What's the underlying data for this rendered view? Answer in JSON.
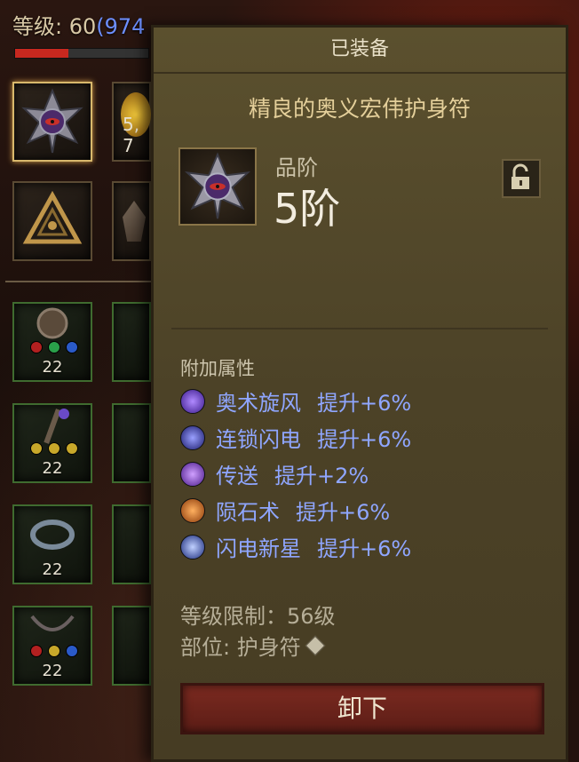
{
  "player": {
    "level_prefix": "等级: 60",
    "paragon": "(974",
    "xp_progress": 0.4
  },
  "background_slots": [
    {
      "label": "5, 7",
      "name": "bag-slot-gold"
    },
    {
      "level": "22"
    },
    {
      "level": "22"
    },
    {
      "level": "22"
    },
    {
      "level": "22"
    }
  ],
  "tooltip": {
    "header": "已装备",
    "item_name": "精良的奥义宏伟护身符",
    "tier_label": "品阶",
    "tier_value": "5阶",
    "attr_title": "附加属性",
    "attributes": [
      {
        "skill": "奥术旋风",
        "boost": "提升+6%",
        "icon": "arcane-orb-icon",
        "color": "#6a3bd6"
      },
      {
        "skill": "连锁闪电",
        "boost": "提升+6%",
        "icon": "chain-lightning-icon",
        "color": "#4a4fd0"
      },
      {
        "skill": "传送",
        "boost": "提升+2%",
        "icon": "teleport-icon",
        "color": "#8a3bd0"
      },
      {
        "skill": "陨石术",
        "boost": "提升+6%",
        "icon": "meteor-icon",
        "color": "#d26a1e"
      },
      {
        "skill": "闪电新星",
        "boost": "提升+6%",
        "icon": "lightning-nova-icon",
        "color": "#3a4ec8"
      }
    ],
    "level_requirement": "等级限制：56级",
    "slot": "部位: 护身符",
    "unequip_label": "卸下"
  },
  "colors": {
    "attribute_text": "#8fa6ff",
    "item_name": "#e4cf9a",
    "unequip_button": "#7b2a20"
  }
}
